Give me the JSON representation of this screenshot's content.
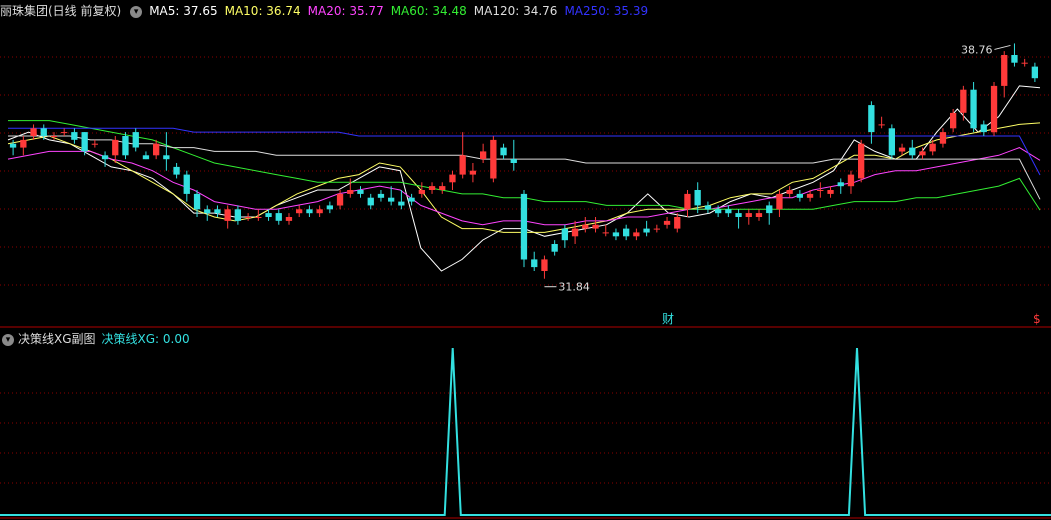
{
  "header": {
    "stock": "丽珠集团(日线 前复权)",
    "ma_items": [
      {
        "label": "MA5: 37.65",
        "color": "#ffffff"
      },
      {
        "label": "MA10: 36.74",
        "color": "#ffff66"
      },
      {
        "label": "MA20: 35.77",
        "color": "#ff44ff"
      },
      {
        "label": "MA60: 34.48",
        "color": "#33ee33"
      },
      {
        "label": "MA120: 34.76",
        "color": "#dddddd"
      },
      {
        "label": "MA250: 35.39",
        "color": "#3333ff"
      }
    ]
  },
  "sub": {
    "title": "决策线XG副图",
    "value_label": "决策线XG: 0.00",
    "value_color": "#33e0e0"
  },
  "markers": {
    "high": "38.76",
    "low": "31.84",
    "cai": "财",
    "s": "$"
  },
  "colors": {
    "up": "#ff3a3a",
    "down": "#33e0e0",
    "grid": "#8b0000",
    "axis": "#b00000"
  },
  "chart_data": [
    {
      "type": "candlestick",
      "ylim": [
        31.5,
        39.2
      ],
      "candles": [
        [
          36.2,
          36.3,
          35.9,
          36.1
        ],
        [
          36.1,
          36.4,
          35.9,
          36.3
        ],
        [
          36.4,
          36.7,
          36.3,
          36.6
        ],
        [
          36.6,
          36.7,
          36.3,
          36.4
        ],
        [
          36.4,
          36.5,
          36.3,
          36.4
        ],
        [
          36.5,
          36.6,
          36.4,
          36.5
        ],
        [
          36.5,
          36.6,
          36.2,
          36.3
        ],
        [
          36.5,
          36.5,
          35.9,
          36.0
        ],
        [
          36.2,
          36.3,
          36.1,
          36.2
        ],
        [
          35.9,
          36.0,
          35.6,
          35.8
        ],
        [
          35.9,
          36.4,
          35.7,
          36.3
        ],
        [
          36.4,
          36.5,
          35.8,
          35.9
        ],
        [
          36.5,
          36.6,
          36.0,
          36.1
        ],
        [
          35.9,
          36.0,
          35.8,
          35.8
        ],
        [
          35.9,
          36.3,
          35.8,
          36.2
        ],
        [
          35.9,
          36.5,
          35.5,
          35.8
        ],
        [
          35.6,
          35.7,
          35.3,
          35.4
        ],
        [
          35.4,
          35.5,
          34.7,
          34.9
        ],
        [
          34.9,
          35.0,
          34.3,
          34.5
        ],
        [
          34.5,
          34.6,
          34.2,
          34.4
        ],
        [
          34.5,
          34.6,
          34.3,
          34.4
        ],
        [
          34.2,
          34.6,
          34.0,
          34.5
        ],
        [
          34.5,
          34.6,
          34.1,
          34.2
        ],
        [
          34.3,
          34.4,
          34.2,
          34.3
        ],
        [
          34.3,
          34.5,
          34.2,
          34.3
        ],
        [
          34.4,
          34.5,
          34.2,
          34.3
        ],
        [
          34.4,
          34.5,
          34.1,
          34.2
        ],
        [
          34.2,
          34.4,
          34.1,
          34.3
        ],
        [
          34.4,
          34.6,
          34.3,
          34.5
        ],
        [
          34.5,
          34.6,
          34.3,
          34.4
        ],
        [
          34.4,
          34.6,
          34.3,
          34.5
        ],
        [
          34.6,
          34.7,
          34.4,
          34.5
        ],
        [
          34.6,
          35.0,
          34.5,
          34.9
        ],
        [
          34.9,
          35.3,
          34.8,
          35.0
        ],
        [
          35.0,
          35.1,
          34.8,
          34.9
        ],
        [
          34.8,
          34.9,
          34.5,
          34.6
        ],
        [
          34.9,
          35.0,
          34.7,
          34.8
        ],
        [
          34.8,
          35.1,
          34.6,
          34.7
        ],
        [
          34.7,
          35.0,
          34.5,
          34.6
        ],
        [
          34.8,
          34.9,
          34.6,
          34.7
        ],
        [
          34.9,
          35.2,
          34.8,
          35.0
        ],
        [
          35.0,
          35.2,
          34.9,
          35.1
        ],
        [
          35.0,
          35.2,
          34.9,
          35.1
        ],
        [
          35.2,
          35.5,
          35.0,
          35.4
        ],
        [
          35.4,
          36.5,
          35.3,
          35.9
        ],
        [
          35.4,
          35.7,
          35.2,
          35.5
        ],
        [
          35.8,
          36.2,
          35.7,
          36.0
        ],
        [
          35.3,
          36.4,
          35.2,
          36.3
        ],
        [
          36.1,
          36.2,
          35.8,
          35.9
        ],
        [
          35.8,
          36.3,
          35.5,
          35.7
        ],
        [
          34.9,
          35.0,
          33.0,
          33.2
        ],
        [
          33.2,
          33.4,
          32.9,
          33.0
        ],
        [
          32.9,
          33.3,
          32.7,
          33.2
        ],
        [
          33.6,
          33.7,
          33.3,
          33.4
        ],
        [
          34.0,
          34.1,
          33.5,
          33.7
        ],
        [
          33.8,
          34.2,
          33.6,
          34.0
        ],
        [
          34.0,
          34.3,
          33.9,
          34.1
        ],
        [
          34.0,
          34.3,
          33.9,
          34.1
        ],
        [
          33.9,
          34.1,
          33.8,
          33.9
        ],
        [
          33.9,
          34.0,
          33.7,
          33.8
        ],
        [
          34.0,
          34.1,
          33.7,
          33.8
        ],
        [
          33.8,
          34.0,
          33.7,
          33.9
        ],
        [
          34.0,
          34.2,
          33.8,
          33.9
        ],
        [
          34.0,
          34.1,
          33.9,
          34.0
        ],
        [
          34.1,
          34.3,
          34.0,
          34.2
        ],
        [
          34.0,
          34.4,
          33.9,
          34.3
        ],
        [
          34.5,
          35.0,
          34.3,
          34.9
        ],
        [
          35.0,
          35.2,
          34.4,
          34.6
        ],
        [
          34.6,
          34.7,
          34.4,
          34.5
        ],
        [
          34.5,
          34.6,
          34.3,
          34.4
        ],
        [
          34.5,
          34.6,
          34.3,
          34.4
        ],
        [
          34.4,
          34.5,
          34.0,
          34.3
        ],
        [
          34.3,
          34.5,
          34.1,
          34.4
        ],
        [
          34.3,
          34.5,
          34.2,
          34.4
        ],
        [
          34.6,
          34.7,
          34.1,
          34.4
        ],
        [
          34.5,
          35.0,
          34.3,
          34.9
        ],
        [
          34.9,
          35.1,
          34.8,
          35.0
        ],
        [
          34.9,
          35.0,
          34.7,
          34.8
        ],
        [
          34.8,
          35.0,
          34.7,
          34.9
        ],
        [
          35.0,
          35.2,
          34.8,
          35.0
        ],
        [
          34.9,
          35.1,
          34.8,
          35.0
        ],
        [
          35.2,
          35.3,
          34.9,
          35.1
        ],
        [
          35.1,
          35.5,
          34.9,
          35.4
        ],
        [
          35.3,
          36.3,
          35.2,
          36.2
        ],
        [
          37.2,
          37.3,
          36.2,
          36.5
        ],
        [
          36.7,
          36.9,
          36.6,
          36.7
        ],
        [
          36.6,
          36.7,
          35.8,
          35.9
        ],
        [
          36.0,
          36.2,
          35.9,
          36.1
        ],
        [
          36.1,
          36.3,
          35.8,
          35.9
        ],
        [
          35.9,
          36.1,
          35.8,
          36.0
        ],
        [
          36.0,
          36.3,
          35.9,
          36.2
        ],
        [
          36.2,
          36.6,
          36.1,
          36.5
        ],
        [
          36.6,
          37.1,
          36.5,
          37.0
        ],
        [
          37.0,
          37.7,
          36.8,
          37.6
        ],
        [
          37.6,
          37.8,
          36.5,
          36.6
        ],
        [
          36.7,
          36.8,
          36.4,
          36.5
        ],
        [
          36.5,
          37.8,
          36.4,
          37.7
        ],
        [
          37.7,
          38.6,
          37.4,
          38.5
        ],
        [
          38.5,
          38.8,
          38.2,
          38.3
        ],
        [
          38.3,
          38.4,
          38.2,
          38.3
        ],
        [
          38.2,
          38.3,
          37.8,
          37.9
        ]
      ],
      "ma": [
        {
          "name": "MA5",
          "color": "#ffffff",
          "values": [
            36.3,
            36.5,
            36.3,
            36.2,
            35.9,
            35.6,
            35.5,
            35.3,
            34.9,
            34.4,
            34.4,
            34.3,
            34.3,
            34.6,
            34.8,
            35.0,
            35.0,
            35.3,
            35.6,
            35.5,
            33.5,
            32.9,
            33.2,
            33.7,
            34.0,
            34.0,
            33.8,
            33.9,
            34.0,
            34.1,
            34.4,
            34.9,
            34.4,
            34.3,
            34.4,
            34.7,
            34.9,
            34.8,
            35.0,
            35.2,
            35.5,
            36.3,
            36.0,
            35.8,
            35.8,
            36.5,
            37.1,
            36.5,
            36.9,
            37.7,
            37.65
          ]
        },
        {
          "name": "MA10",
          "color": "#ffff66",
          "values": [
            36.2,
            36.3,
            36.4,
            36.2,
            36.0,
            35.8,
            35.5,
            35.2,
            34.9,
            34.5,
            34.3,
            34.2,
            34.3,
            34.6,
            34.9,
            35.1,
            35.3,
            35.4,
            35.7,
            35.6,
            35.0,
            34.3,
            34.0,
            34.0,
            33.9,
            33.9,
            33.9,
            34.0,
            34.1,
            34.2,
            34.4,
            34.5,
            34.5,
            34.5,
            34.6,
            34.8,
            34.9,
            34.9,
            35.2,
            35.3,
            35.6,
            35.9,
            35.9,
            35.8,
            36.1,
            36.3,
            36.4,
            36.5,
            36.6,
            36.7,
            36.74
          ]
        },
        {
          "name": "MA20",
          "color": "#ff44ff",
          "values": [
            35.8,
            35.9,
            36.0,
            36.0,
            36.0,
            35.8,
            35.7,
            35.5,
            35.2,
            35.0,
            34.7,
            34.6,
            34.5,
            34.5,
            34.6,
            34.7,
            34.9,
            35.0,
            35.1,
            35.0,
            34.6,
            34.4,
            34.2,
            34.1,
            34.2,
            34.2,
            34.1,
            34.1,
            34.2,
            34.2,
            34.3,
            34.3,
            34.4,
            34.5,
            34.5,
            34.6,
            34.7,
            34.8,
            34.8,
            35.0,
            35.1,
            35.2,
            35.4,
            35.5,
            35.5,
            35.6,
            35.7,
            35.8,
            35.9,
            36.1,
            35.77
          ]
        },
        {
          "name": "MA60",
          "color": "#33ee33",
          "values": [
            36.8,
            36.8,
            36.8,
            36.7,
            36.6,
            36.5,
            36.4,
            36.3,
            36.1,
            35.9,
            35.7,
            35.6,
            35.5,
            35.4,
            35.3,
            35.2,
            35.2,
            35.2,
            35.2,
            35.2,
            35.1,
            35.0,
            34.9,
            34.9,
            34.8,
            34.8,
            34.7,
            34.7,
            34.7,
            34.6,
            34.6,
            34.6,
            34.6,
            34.5,
            34.5,
            34.5,
            34.5,
            34.5,
            34.5,
            34.5,
            34.6,
            34.7,
            34.7,
            34.7,
            34.8,
            34.8,
            34.9,
            35.0,
            35.1,
            35.3,
            34.48
          ]
        },
        {
          "name": "MA120",
          "color": "#dddddd",
          "values": [
            36.4,
            36.4,
            36.4,
            36.4,
            36.3,
            36.3,
            36.2,
            36.2,
            36.1,
            36.1,
            36.0,
            36.0,
            36.0,
            35.9,
            35.9,
            35.9,
            35.9,
            35.9,
            35.9,
            35.9,
            35.9,
            35.9,
            35.9,
            35.8,
            35.8,
            35.8,
            35.8,
            35.8,
            35.7,
            35.7,
            35.7,
            35.7,
            35.7,
            35.7,
            35.7,
            35.7,
            35.7,
            35.7,
            35.7,
            35.7,
            35.8,
            35.8,
            35.8,
            35.8,
            35.8,
            35.8,
            35.8,
            35.8,
            35.8,
            35.8,
            34.76
          ]
        },
        {
          "name": "MA250",
          "color": "#3333ff",
          "values": [
            36.6,
            36.6,
            36.6,
            36.6,
            36.6,
            36.6,
            36.6,
            36.6,
            36.6,
            36.5,
            36.5,
            36.5,
            36.5,
            36.5,
            36.5,
            36.5,
            36.5,
            36.4,
            36.4,
            36.4,
            36.4,
            36.4,
            36.4,
            36.4,
            36.4,
            36.4,
            36.4,
            36.4,
            36.4,
            36.4,
            36.4,
            36.4,
            36.4,
            36.4,
            36.4,
            36.4,
            36.4,
            36.4,
            36.4,
            36.4,
            36.4,
            36.4,
            36.4,
            36.4,
            36.4,
            36.4,
            36.4,
            36.4,
            36.4,
            36.4,
            35.39
          ]
        }
      ]
    },
    {
      "type": "line",
      "series": [
        {
          "name": "决策线XG",
          "values": [
            0,
            0,
            0,
            0,
            0,
            0,
            0,
            0,
            0,
            0,
            0,
            0,
            0,
            0,
            0,
            0,
            0,
            0,
            0,
            0,
            0,
            0,
            0,
            0,
            0,
            0,
            0,
            0,
            0,
            0,
            0,
            0,
            0,
            0,
            0,
            0,
            0,
            0,
            0,
            0,
            0,
            0,
            0,
            0,
            0,
            0,
            0,
            0,
            0,
            0,
            0,
            0,
            0,
            0,
            0,
            0,
            1,
            0,
            0,
            0,
            0,
            0,
            0,
            0,
            0,
            0,
            0,
            0,
            0,
            0,
            0,
            0,
            0,
            0,
            0,
            0,
            0,
            0,
            0,
            0,
            0,
            0,
            0,
            0,
            0,
            0,
            0,
            0,
            0,
            0,
            0,
            0,
            0,
            0,
            0,
            0,
            0,
            0,
            0,
            0,
            0,
            0,
            0,
            0,
            0,
            0,
            1,
            0,
            0,
            0,
            0,
            0,
            0,
            0,
            0,
            0,
            0,
            0,
            0,
            0,
            0,
            0,
            0,
            0,
            0,
            0,
            0,
            0,
            0,
            0,
            0
          ]
        }
      ],
      "ylim": [
        0,
        1
      ]
    }
  ]
}
